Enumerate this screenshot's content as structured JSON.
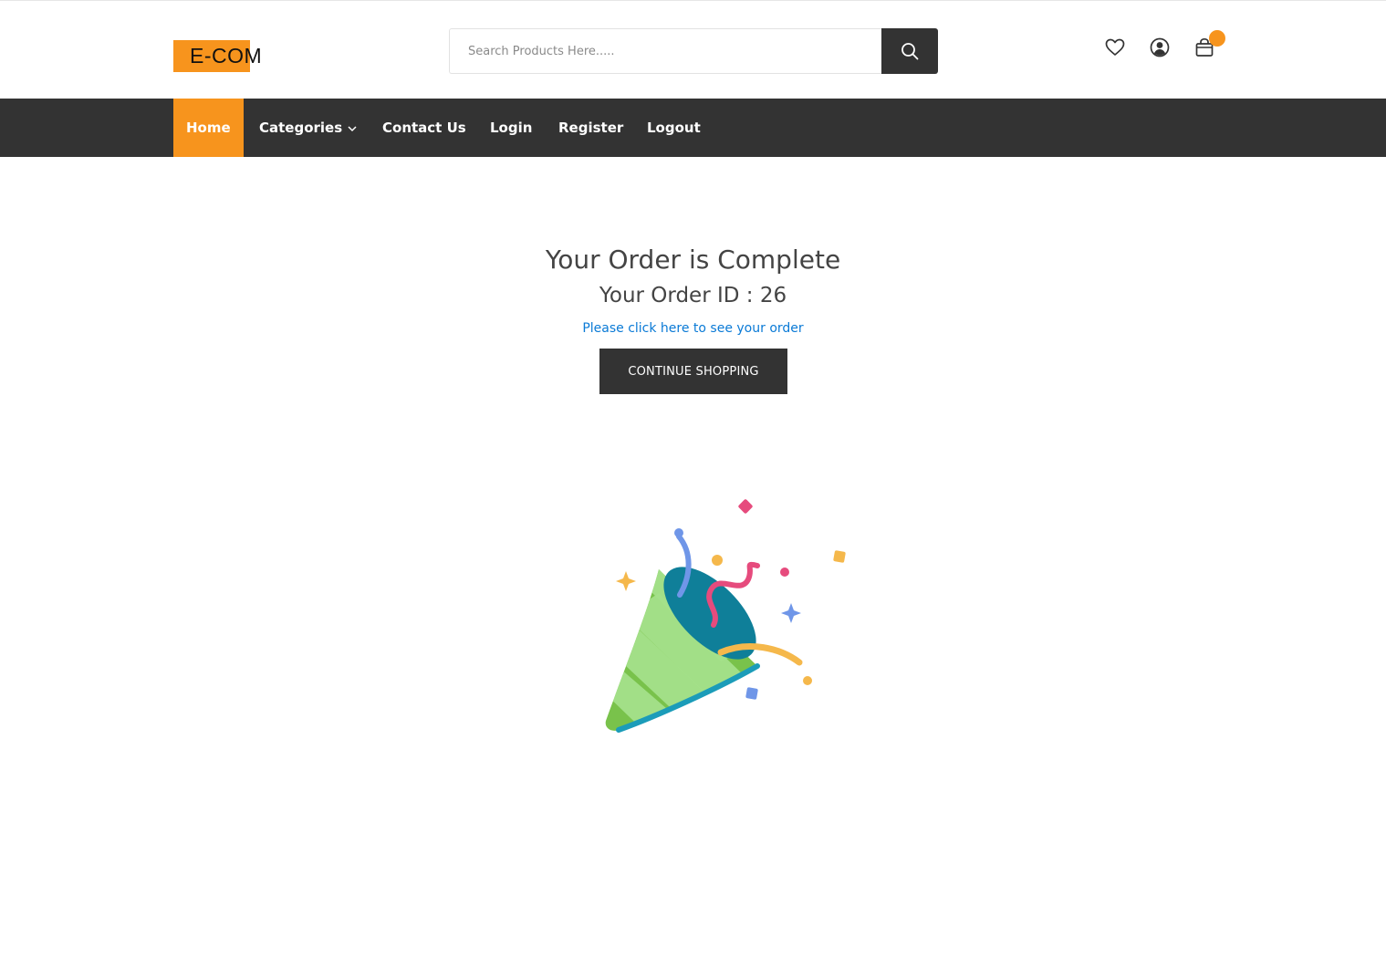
{
  "header": {
    "logo_text": "E-COM",
    "search": {
      "placeholder": "Search Products Here.....",
      "button_icon": "search-icon"
    },
    "icons": [
      "heart-icon",
      "user-circle-icon",
      "shopping-bag-icon"
    ]
  },
  "nav": {
    "items": [
      {
        "label": "Home",
        "active": true
      },
      {
        "label": "Categories",
        "has_dropdown": true
      },
      {
        "label": "Contact Us"
      },
      {
        "label": "Login"
      },
      {
        "label": "Register"
      },
      {
        "label": "Logout"
      }
    ]
  },
  "main": {
    "title": "Your Order is Complete",
    "order_id_text": "Your Order ID : 26",
    "order_link": "Please click here to see your order",
    "continue_button": "CONTINUE SHOPPING",
    "illustration": "party-popper-icon"
  },
  "colors": {
    "accent": "#f7941d",
    "dark": "#333333",
    "link": "#0a7ad6",
    "text": "#444444"
  }
}
